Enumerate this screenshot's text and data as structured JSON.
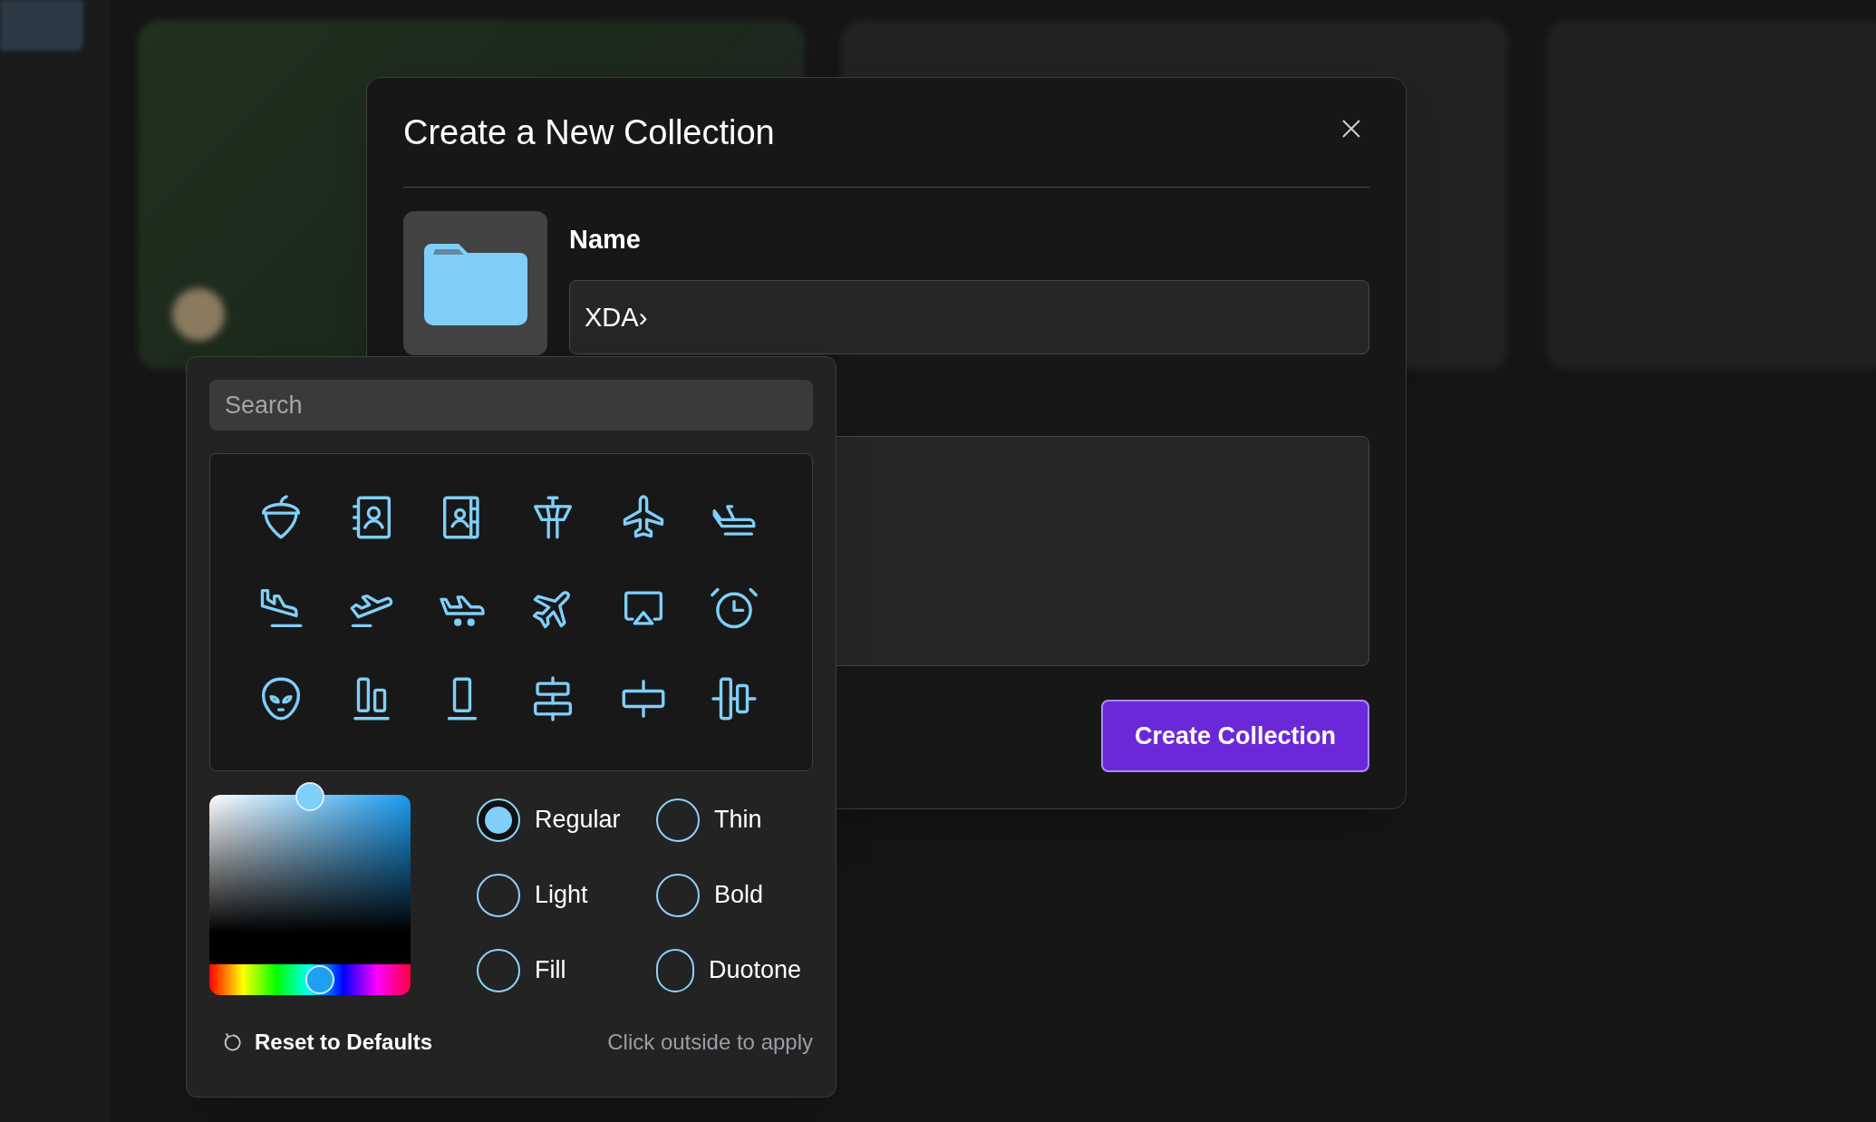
{
  "dialog": {
    "title": "Create a New Collection",
    "name_label": "Name",
    "name_value": "XDA›",
    "submit": "Create Collection"
  },
  "icon_picker": {
    "search": {
      "placeholder": "Search"
    },
    "icons": [
      {
        "kind": "acorn"
      },
      {
        "kind": "addressbook"
      },
      {
        "kind": "addressbooktabs"
      },
      {
        "kind": "tower"
      },
      {
        "kind": "plane"
      },
      {
        "kind": "planeflight"
      },
      {
        "kind": "planelanding"
      },
      {
        "kind": "planetakeoff"
      },
      {
        "kind": "planetaxi"
      },
      {
        "kind": "planetilt"
      },
      {
        "kind": "airplay"
      },
      {
        "kind": "alarm"
      },
      {
        "kind": "alien"
      },
      {
        "kind": "alignbottom"
      },
      {
        "kind": "alignbottomsimple"
      },
      {
        "kind": "centerh"
      },
      {
        "kind": "centerhsimple"
      },
      {
        "kind": "centerv"
      }
    ],
    "shade": {
      "level": 0.5
    },
    "hue": {
      "level": 0.55
    },
    "weights": [
      {
        "label": "Regular",
        "selected": true
      },
      {
        "label": "Thin",
        "selected": false
      },
      {
        "label": "Light",
        "selected": false
      },
      {
        "label": "Bold",
        "selected": false
      },
      {
        "label": "Fill",
        "selected": false
      },
      {
        "label": "Duotone",
        "selected": false
      }
    ],
    "reset": "Reset to Defaults",
    "hint": "Click outside to apply"
  }
}
